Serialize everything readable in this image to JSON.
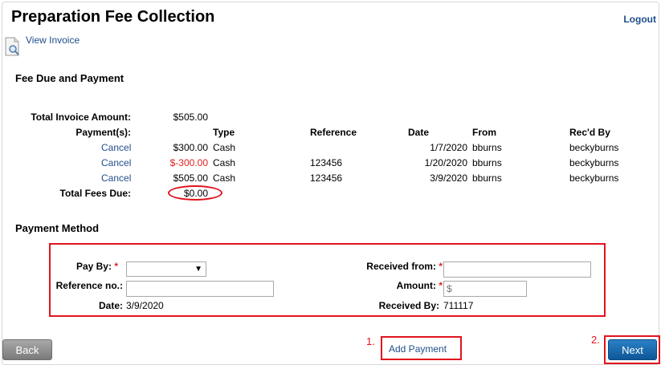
{
  "header": {
    "title": "Preparation Fee Collection",
    "logout": "Logout",
    "view_invoice": "View Invoice"
  },
  "fee_section": {
    "title": "Fee Due and Payment",
    "total_invoice_label": "Total Invoice Amount:",
    "total_invoice_value": "$505.00",
    "payments_label": "Payment(s):",
    "columns": {
      "type": "Type",
      "reference": "Reference",
      "date": "Date",
      "from": "From",
      "recd_by": "Rec'd By"
    },
    "payments": [
      {
        "action": "Cancel",
        "amount": "$300.00",
        "type": "Cash",
        "reference": "",
        "date": "1/7/2020",
        "from": "bburns",
        "recd_by": "beckyburns"
      },
      {
        "action": "Cancel",
        "amount": "$-300.00",
        "type": "Cash",
        "reference": "123456",
        "date": "1/20/2020",
        "from": "bburns",
        "recd_by": "beckyburns"
      },
      {
        "action": "Cancel",
        "amount": "$505.00",
        "type": "Cash",
        "reference": "123456",
        "date": "3/9/2020",
        "from": "bburns",
        "recd_by": "beckyburns"
      }
    ],
    "total_fees_label": "Total Fees Due:",
    "total_fees_value": "$0.00"
  },
  "payment_method": {
    "title": "Payment Method",
    "pay_by_label": "Pay By:",
    "required_mark": "*",
    "pay_by_value": "",
    "reference_label": "Reference no.:",
    "reference_value": "",
    "date_label": "Date:",
    "date_value": "3/9/2020",
    "received_from_label": "Received from:",
    "received_from_value": "",
    "amount_label": "Amount:",
    "amount_placeholder": "$",
    "received_by_label": "Received By:",
    "received_by_value": "711117"
  },
  "footer": {
    "back": "Back",
    "add_payment": "Add Payment",
    "next": "Next",
    "step1": "1.",
    "step2": "2."
  },
  "colors": {
    "link": "#1f4e8c",
    "highlight": "#e0141e",
    "next_button": "#0d5798",
    "back_button": "#7a7a7a"
  },
  "icons": {
    "invoice": "document-magnifier-icon",
    "select": "chevron-down-icon"
  }
}
